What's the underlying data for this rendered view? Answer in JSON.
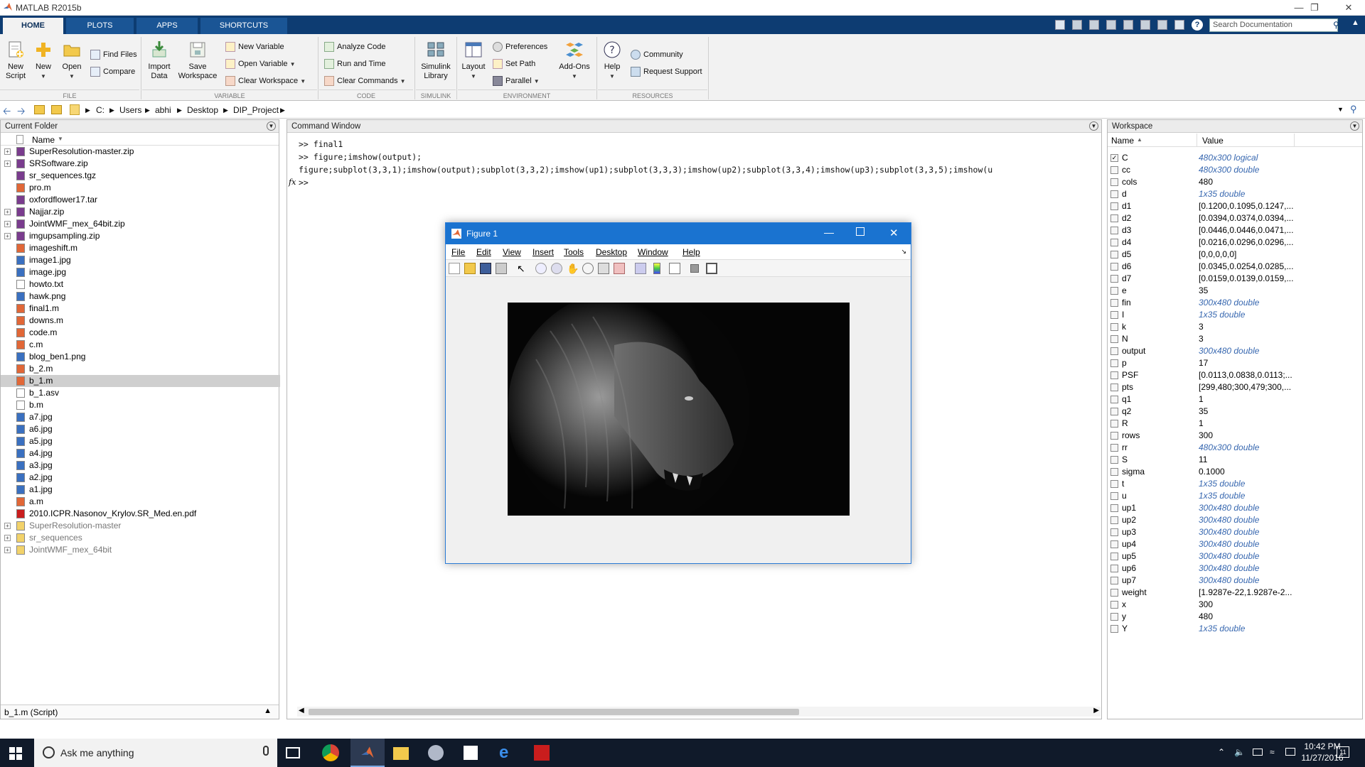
{
  "window": {
    "title": "MATLAB R2015b"
  },
  "tabs": [
    {
      "label": "HOME"
    },
    {
      "label": "PLOTS"
    },
    {
      "label": "APPS"
    },
    {
      "label": "SHORTCUTS"
    }
  ],
  "search_doc": {
    "placeholder": "Search Documentation"
  },
  "ribbon": {
    "file": {
      "new_script": "New\nScript",
      "new": "New",
      "open": "Open",
      "find_files": "Find Files",
      "compare": "Compare",
      "group": "FILE"
    },
    "variable": {
      "import_data": "Import\nData",
      "save_workspace": "Save\nWorkspace",
      "new_variable": "New Variable",
      "open_variable": "Open Variable",
      "clear_workspace": "Clear Workspace",
      "group": "VARIABLE"
    },
    "code": {
      "analyze_code": "Analyze Code",
      "run_and_time": "Run and Time",
      "clear_commands": "Clear Commands",
      "group": "CODE"
    },
    "simulink": {
      "library": "Simulink\nLibrary",
      "group": "SIMULINK"
    },
    "environment": {
      "layout": "Layout",
      "preferences": "Preferences",
      "set_path": "Set Path",
      "parallel": "Parallel",
      "addons": "Add-Ons",
      "group": "ENVIRONMENT"
    },
    "resources": {
      "help": "Help",
      "community": "Community",
      "request_support": "Request Support",
      "group": "RESOURCES"
    }
  },
  "address": {
    "path": [
      "C:",
      "Users",
      "abhi",
      "Desktop",
      "DIP_Project"
    ]
  },
  "current_folder": {
    "title": "Current Folder",
    "column": "Name",
    "files": [
      {
        "name": "SuperResolution-master.zip",
        "type": "zip",
        "expand": true
      },
      {
        "name": "SRSoftware.zip",
        "type": "zip",
        "expand": true
      },
      {
        "name": "sr_sequences.tgz",
        "type": "zip",
        "expand": false
      },
      {
        "name": "pro.m",
        "type": "m",
        "expand": false
      },
      {
        "name": "oxfordflower17.tar",
        "type": "zip",
        "expand": false
      },
      {
        "name": "Najjar.zip",
        "type": "zip",
        "expand": true
      },
      {
        "name": "JointWMF_mex_64bit.zip",
        "type": "zip",
        "expand": true
      },
      {
        "name": "imgupsampling.zip",
        "type": "zip",
        "expand": true
      },
      {
        "name": "imageshift.m",
        "type": "fn",
        "expand": false
      },
      {
        "name": "image1.jpg",
        "type": "img",
        "expand": false
      },
      {
        "name": "image.jpg",
        "type": "img",
        "expand": false
      },
      {
        "name": "howto.txt",
        "type": "txt",
        "expand": false
      },
      {
        "name": "hawk.png",
        "type": "img",
        "expand": false
      },
      {
        "name": "final1.m",
        "type": "m",
        "expand": false
      },
      {
        "name": "downs.m",
        "type": "fn",
        "expand": false
      },
      {
        "name": "code.m",
        "type": "fn",
        "expand": false
      },
      {
        "name": "c.m",
        "type": "m",
        "expand": false
      },
      {
        "name": "blog_ben1.png",
        "type": "img",
        "expand": false
      },
      {
        "name": "b_2.m",
        "type": "m",
        "expand": false
      },
      {
        "name": "b_1.m",
        "type": "m",
        "expand": false,
        "selected": true
      },
      {
        "name": "b_1.asv",
        "type": "txt",
        "expand": false
      },
      {
        "name": "b.m",
        "type": "txt",
        "expand": false
      },
      {
        "name": "a7.jpg",
        "type": "img",
        "expand": false
      },
      {
        "name": "a6.jpg",
        "type": "img",
        "expand": false
      },
      {
        "name": "a5.jpg",
        "type": "img",
        "expand": false
      },
      {
        "name": "a4.jpg",
        "type": "img",
        "expand": false
      },
      {
        "name": "a3.jpg",
        "type": "img",
        "expand": false
      },
      {
        "name": "a2.jpg",
        "type": "img",
        "expand": false
      },
      {
        "name": "a1.jpg",
        "type": "img",
        "expand": false
      },
      {
        "name": "a.m",
        "type": "m",
        "expand": false
      },
      {
        "name": "2010.ICPR.Nasonov_Krylov.SR_Med.en.pdf",
        "type": "pdf",
        "expand": false
      },
      {
        "name": "SuperResolution-master",
        "type": "folder",
        "expand": true,
        "dim": true
      },
      {
        "name": "sr_sequences",
        "type": "folder",
        "expand": true,
        "dim": true
      },
      {
        "name": "JointWMF_mex_64bit",
        "type": "folder",
        "expand": true,
        "dim": true
      }
    ],
    "details": "b_1.m  (Script)"
  },
  "command_window": {
    "title": "Command Window",
    "lines": [
      ">> final1",
      ">> figure;imshow(output);",
      "figure;subplot(3,3,1);imshow(output);subplot(3,3,2);imshow(up1);subplot(3,3,3);imshow(up2);subplot(3,3,4);imshow(up3);subplot(3,3,5);imshow(u"
    ],
    "prompt": ">>",
    "fx": "fx"
  },
  "workspace": {
    "title": "Workspace",
    "col_name": "Name",
    "col_value": "Value",
    "vars": [
      {
        "name": "C",
        "value": "480x300 logical",
        "italic": true,
        "check": true
      },
      {
        "name": "cc",
        "value": "480x300 double",
        "italic": true
      },
      {
        "name": "cols",
        "value": "480",
        "italic": false
      },
      {
        "name": "d",
        "value": "1x35 double",
        "italic": true
      },
      {
        "name": "d1",
        "value": "[0.1200,0.1095,0.1247,...",
        "italic": false
      },
      {
        "name": "d2",
        "value": "[0.0394,0.0374,0.0394,...",
        "italic": false
      },
      {
        "name": "d3",
        "value": "[0.0446,0.0446,0.0471,...",
        "italic": false
      },
      {
        "name": "d4",
        "value": "[0.0216,0.0296,0.0296,...",
        "italic": false
      },
      {
        "name": "d5",
        "value": "[0,0,0,0,0]",
        "italic": false
      },
      {
        "name": "d6",
        "value": "[0.0345,0.0254,0.0285,...",
        "italic": false
      },
      {
        "name": "d7",
        "value": "[0.0159,0.0139,0.0159,...",
        "italic": false
      },
      {
        "name": "e",
        "value": "35",
        "italic": false
      },
      {
        "name": "fin",
        "value": "300x480 double",
        "italic": true
      },
      {
        "name": "I",
        "value": "1x35 double",
        "italic": true
      },
      {
        "name": "k",
        "value": "3",
        "italic": false
      },
      {
        "name": "N",
        "value": "3",
        "italic": false
      },
      {
        "name": "output",
        "value": "300x480 double",
        "italic": true
      },
      {
        "name": "p",
        "value": "17",
        "italic": false
      },
      {
        "name": "PSF",
        "value": "[0.0113,0.0838,0.0113;...",
        "italic": false
      },
      {
        "name": "pts",
        "value": "[299,480;300,479;300,...",
        "italic": false
      },
      {
        "name": "q1",
        "value": "1",
        "italic": false
      },
      {
        "name": "q2",
        "value": "35",
        "italic": false
      },
      {
        "name": "R",
        "value": "1",
        "italic": false
      },
      {
        "name": "rows",
        "value": "300",
        "italic": false
      },
      {
        "name": "rr",
        "value": "480x300 double",
        "italic": true
      },
      {
        "name": "S",
        "value": "11",
        "italic": false
      },
      {
        "name": "sigma",
        "value": "0.1000",
        "italic": false
      },
      {
        "name": "t",
        "value": "1x35 double",
        "italic": true
      },
      {
        "name": "u",
        "value": "1x35 double",
        "italic": true
      },
      {
        "name": "up1",
        "value": "300x480 double",
        "italic": true
      },
      {
        "name": "up2",
        "value": "300x480 double",
        "italic": true
      },
      {
        "name": "up3",
        "value": "300x480 double",
        "italic": true
      },
      {
        "name": "up4",
        "value": "300x480 double",
        "italic": true
      },
      {
        "name": "up5",
        "value": "300x480 double",
        "italic": true
      },
      {
        "name": "up6",
        "value": "300x480 double",
        "italic": true
      },
      {
        "name": "up7",
        "value": "300x480 double",
        "italic": true
      },
      {
        "name": "weight",
        "value": "[1.9287e-22,1.9287e-2...",
        "italic": false
      },
      {
        "name": "x",
        "value": "300",
        "italic": false
      },
      {
        "name": "y",
        "value": "480",
        "italic": false
      },
      {
        "name": "Y",
        "value": "1x35 double",
        "italic": true
      }
    ]
  },
  "figure": {
    "title": "Figure 1",
    "menus": [
      "File",
      "Edit",
      "View",
      "Insert",
      "Tools",
      "Desktop",
      "Window",
      "Help"
    ]
  },
  "taskbar": {
    "search": "Ask me anything",
    "time": "10:42 PM",
    "date": "11/27/2016",
    "notif_count": "11"
  },
  "colors": {
    "accent": "#0d3c72",
    "figure_title": "#1a73d0",
    "link": "#3868b0",
    "taskbar": "#101a2a"
  }
}
